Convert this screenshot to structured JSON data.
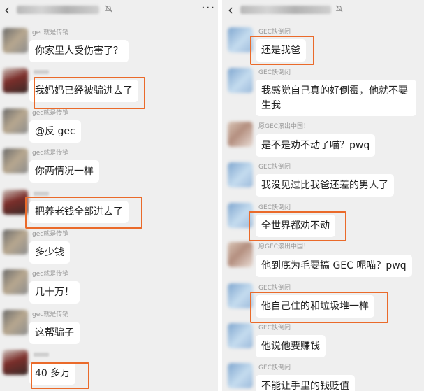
{
  "left_chat": {
    "back_icon": "back-arrow-icon",
    "more_icon": "more-dots-icon",
    "more_label": "···",
    "messages": [
      {
        "sender": "gec就是传销",
        "text": "你家里人受伤害了？"
      },
      {
        "sender": "",
        "text": "我妈妈已经被骗进去了"
      },
      {
        "sender": "gec就是传销",
        "text": "@反 gec"
      },
      {
        "sender": "gec就是传销",
        "text": "你两情况一样"
      },
      {
        "sender": "",
        "text": "把养老钱全部进去了"
      },
      {
        "sender": "gec就是传销",
        "text": "多少钱"
      },
      {
        "sender": "gec就是传销",
        "text": "几十万！"
      },
      {
        "sender": "gec就是传销",
        "text": "这帮骗子"
      },
      {
        "sender": "",
        "text": "40 多万"
      }
    ]
  },
  "right_chat": {
    "back_icon": "back-arrow-icon",
    "messages": [
      {
        "sender": "GEC快倒闭",
        "text": "还是我爸"
      },
      {
        "sender": "GEC快倒闭",
        "text": "我感觉自己真的好倒霉，他就不要生我"
      },
      {
        "sender": "愿GEC滚出中国！",
        "text": "是不是劝不动了喵？pwq"
      },
      {
        "sender": "GEC快倒闭",
        "text": "我没见过比我爸还差的男人了"
      },
      {
        "sender": "GEC快倒闭",
        "text": "全世界都劝不动"
      },
      {
        "sender": "愿GEC滚出中国！",
        "text": "他到底为毛要搞 GEC 呢喵？pwq"
      },
      {
        "sender": "GEC快倒闭",
        "text": "他自己住的和垃圾堆一样"
      },
      {
        "sender": "GEC快倒闭",
        "text": "他说他要赚钱"
      },
      {
        "sender": "GEC快倒闭",
        "text": "不能让手里的钱贬值"
      }
    ]
  },
  "colors": {
    "background": "#efefef",
    "bubble": "#ffffff",
    "highlight": "#ea6a2a",
    "sender_text": "#999999"
  }
}
